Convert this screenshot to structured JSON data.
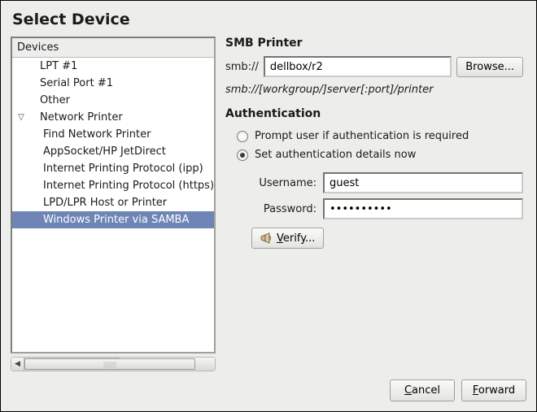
{
  "window": {
    "title": "Select Device"
  },
  "sidebar": {
    "header": "Devices",
    "items": [
      {
        "label": "LPT #1",
        "level": 1,
        "selected": false,
        "expander": ""
      },
      {
        "label": "Serial Port #1",
        "level": 1,
        "selected": false,
        "expander": ""
      },
      {
        "label": "Other",
        "level": 1,
        "selected": false,
        "expander": ""
      },
      {
        "label": "Network Printer",
        "level": 1,
        "selected": false,
        "expander": "▽"
      },
      {
        "label": "Find Network Printer",
        "level": 2,
        "selected": false,
        "expander": ""
      },
      {
        "label": "AppSocket/HP JetDirect",
        "level": 2,
        "selected": false,
        "expander": ""
      },
      {
        "label": "Internet Printing Protocol (ipp)",
        "level": 2,
        "selected": false,
        "expander": ""
      },
      {
        "label": "Internet Printing Protocol (https)",
        "level": 2,
        "selected": false,
        "expander": ""
      },
      {
        "label": "LPD/LPR Host or Printer",
        "level": 2,
        "selected": false,
        "expander": ""
      },
      {
        "label": "Windows Printer via SAMBA",
        "level": 2,
        "selected": true,
        "expander": ""
      }
    ]
  },
  "smb": {
    "panel_title": "SMB Printer",
    "prefix_label": "smb://",
    "uri_value": "dellbox/r2",
    "browse_label": "Browse...",
    "hint": "smb://[workgroup/]server[:port]/printer"
  },
  "auth": {
    "panel_title": "Authentication",
    "option_prompt": "Prompt user if authentication is required",
    "option_set": "Set authentication details now",
    "selected": "set",
    "username_label": "Username:",
    "username_value": "guest",
    "password_label": "Password:",
    "password_value": "••••••••••",
    "verify_label": "Verify..."
  },
  "footer": {
    "cancel": "Cancel",
    "forward": "Forward"
  }
}
